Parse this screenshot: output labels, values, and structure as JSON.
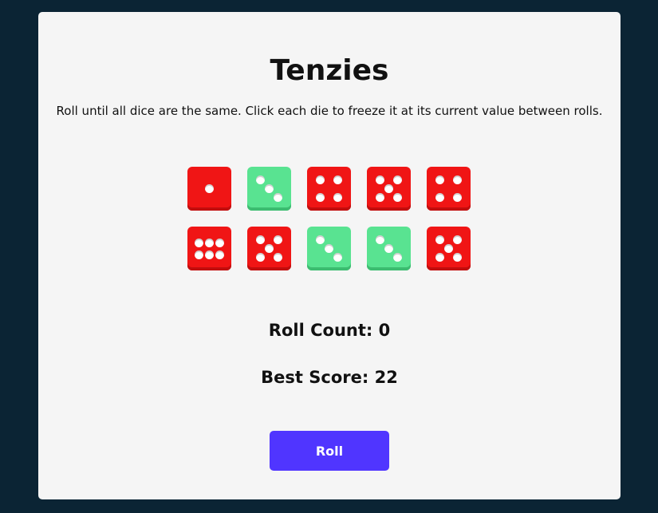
{
  "game": {
    "title": "Tenzies",
    "instructions": "Roll until all dice are the same. Click each die to freeze it at its current value between rolls.",
    "roll_count_text": "Roll Count: 0",
    "best_score_text": "Best Score: 22",
    "roll_button_label": "Roll"
  },
  "colors": {
    "background": "#0b2434",
    "card": "#f5f5f5",
    "die_unfrozen": "#f01515",
    "die_frozen": "#59e391",
    "pip": "#ffffff",
    "button": "#5035ff"
  },
  "dice": [
    {
      "value": 1,
      "held": false
    },
    {
      "value": 3,
      "held": true
    },
    {
      "value": 4,
      "held": false
    },
    {
      "value": 5,
      "held": false
    },
    {
      "value": 4,
      "held": false
    },
    {
      "value": 6,
      "held": false
    },
    {
      "value": 5,
      "held": false
    },
    {
      "value": 3,
      "held": true
    },
    {
      "value": 3,
      "held": true
    },
    {
      "value": 5,
      "held": false
    }
  ]
}
